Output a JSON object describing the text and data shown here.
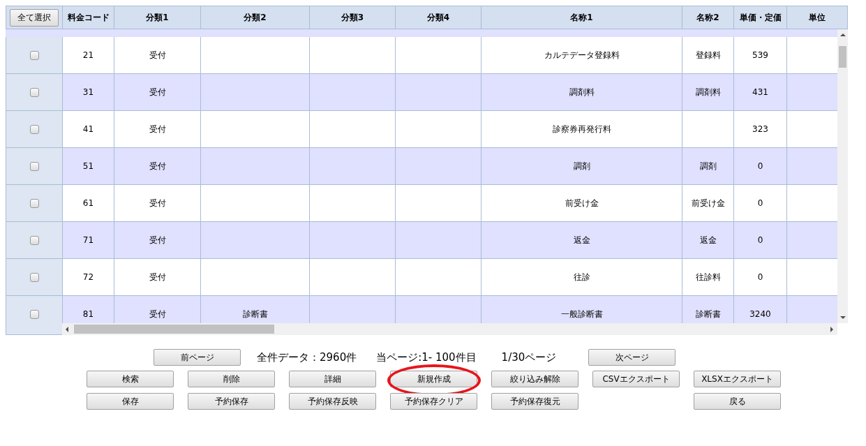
{
  "table": {
    "select_all_button": "全て選択",
    "columns": [
      "料金コード",
      "分類1",
      "分類2",
      "分類3",
      "分類4",
      "名称1",
      "名称2",
      "単価・定価",
      "単位"
    ],
    "rows": [
      {
        "checked": false,
        "cells": [
          "21",
          "受付",
          null,
          null,
          null,
          "カルテデータ登録料",
          "登録料",
          "539",
          null
        ]
      },
      {
        "checked": false,
        "cells": [
          "31",
          "受付",
          null,
          null,
          null,
          "調剤料",
          "調剤料",
          "431",
          null
        ]
      },
      {
        "checked": false,
        "cells": [
          "41",
          "受付",
          null,
          null,
          null,
          "診察券再発行料",
          null,
          "323",
          null
        ]
      },
      {
        "checked": false,
        "cells": [
          "51",
          "受付",
          null,
          null,
          null,
          "調剤",
          "調剤",
          "0",
          null
        ]
      },
      {
        "checked": false,
        "cells": [
          "61",
          "受付",
          null,
          null,
          null,
          "前受け金",
          "前受け金",
          "0",
          null
        ]
      },
      {
        "checked": false,
        "cells": [
          "71",
          "受付",
          null,
          null,
          null,
          "返金",
          "返金",
          "0",
          null
        ]
      },
      {
        "checked": false,
        "cells": [
          "72",
          "受付",
          null,
          null,
          null,
          "往診",
          "往診料",
          "0",
          null
        ]
      },
      {
        "checked": false,
        "cells": [
          "81",
          "受付",
          "診断書",
          null,
          null,
          "一般診断書",
          "診断書",
          "3240",
          null
        ]
      }
    ]
  },
  "pager": {
    "prev_button": "前ページ",
    "total": "全件データ：2960件",
    "range": "当ページ:1- 100件目",
    "page": "1/30ページ",
    "next_button": "次ページ"
  },
  "button_rows": [
    [
      {
        "label": "検索",
        "highlighted": false
      },
      {
        "label": "削除",
        "highlighted": false
      },
      {
        "label": "詳細",
        "highlighted": false
      },
      {
        "label": "新規作成",
        "highlighted": true
      },
      {
        "label": "絞り込み解除",
        "highlighted": false
      },
      {
        "label": "CSVエクスポート",
        "highlighted": false
      },
      {
        "label": "XLSXエクスポート",
        "highlighted": false
      }
    ],
    [
      {
        "label": "保存",
        "highlighted": false
      },
      {
        "label": "予約保存",
        "highlighted": false
      },
      {
        "label": "予約保存反映",
        "highlighted": false
      },
      {
        "label": "予約保存クリア",
        "highlighted": false
      },
      {
        "label": "予約保存復元",
        "highlighted": false
      },
      {
        "label": "戻る",
        "highlighted": false
      }
    ]
  ]
}
